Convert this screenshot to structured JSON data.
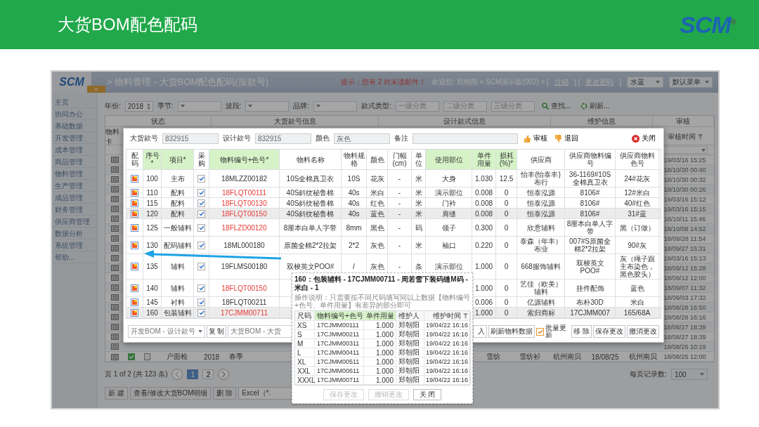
{
  "slide": {
    "title": "大货BOM配色配码",
    "logo": "SCM",
    "logo_mark": "®"
  },
  "header": {
    "logo": "SCM",
    "collapse": "«",
    "breadcrumb": "> 物料管理 - 大货BOM配色配码(按款号)",
    "notice": "提示：您有 2 封未读邮件！",
    "welcome": "欢迎您: 郑朝阳 < SCM演示版(002) > [",
    "logout": "注销",
    "separator": "] [",
    "change_password": "更改密码",
    "closing": "]",
    "theme": "水蓝",
    "menu_mode": "默认菜单"
  },
  "sidebar": {
    "items": [
      "主页",
      "协同办公",
      "基础数据",
      "开发管理",
      "成本管理",
      "商品管理",
      "物料管理",
      "生产管理",
      "成品管理",
      "财务管理",
      "供应商管理",
      "数据分析",
      "系统管理",
      "帮助..."
    ]
  },
  "filters": [
    {
      "kind": "spinner",
      "label": "年份:",
      "value": "2018"
    },
    {
      "kind": "select",
      "label": "季节:"
    },
    {
      "kind": "select",
      "label": "波段:"
    },
    {
      "kind": "select",
      "label": "品牌:"
    },
    {
      "kind": "category",
      "label": "款式类型:",
      "placeholders": [
        "一级分类",
        "二级分类",
        "三级分类"
      ]
    }
  ],
  "find_button": "查找...",
  "refresh_button": "刷新...",
  "table": {
    "groups": [
      "状态",
      "大货款号信息",
      "设计款式信息",
      "维护信息",
      "审核"
    ],
    "first_column": "物料卡",
    "review_time_column": "审核时间",
    "rows": [
      {
        "review_time": "19/03/16 15:25"
      },
      {
        "review_time": "18/10/30 00:40"
      },
      {
        "review_time": "18/10/30 00:32"
      },
      {
        "review_time": "18/10/30 00:26"
      },
      {
        "review_time": "19/03/16 15:12"
      },
      {
        "review_time": "19/03/16 15:15"
      },
      {
        "review_time": "18/10/11 15:46"
      },
      {
        "review_time": "18/10/08 14:52"
      },
      {
        "review_time": "18/09/28 11:54"
      },
      {
        "review_time": "18/09/27 15:31"
      },
      {
        "review_time": "19/03/16 15:13"
      },
      {
        "review_time": "18/09/12 15:28"
      },
      {
        "review_time": "18/09/12 12:00"
      },
      {
        "review_time": "18/09/07 11:32"
      },
      {
        "review_time": "18/09/03 17:32"
      },
      {
        "review_time": "18/08/28 16:50"
      },
      {
        "review_time": "18/08/28 16:16"
      },
      {
        "review_time": "18/08/27 18:39"
      },
      {
        "review_time": "18/08/27 18:39"
      },
      {
        "review_time": "18/08/26 10:19"
      }
    ],
    "last_row": {
      "cells": [
        "户面检",
        "2018",
        "春季",
        "雪纺",
        "雪纺衫",
        "杭州南贝",
        "18/08/25",
        "杭州南贝"
      ],
      "review_time": "18/08/25 12:00"
    }
  },
  "pager": {
    "summary": "页 1 of 2 (共 123 条)",
    "pages": [
      {
        "label": "1",
        "selected": true
      },
      {
        "label": "2",
        "selected": false
      }
    ],
    "page_size_label": "每页记录数:",
    "page_size": "100"
  },
  "actions": [
    "新 建",
    "查看/修改大货BOM明细",
    "删 除"
  ],
  "export_format": "Excel（*.",
  "dialog": {
    "fields": [
      {
        "label": "大货款号",
        "value": "832915"
      },
      {
        "label": "设计款号",
        "value": "832915"
      },
      {
        "label": "颜色",
        "value": "灰色"
      },
      {
        "label": "备注"
      }
    ],
    "approve": "审核",
    "reject": "退回",
    "close": "关闭",
    "columns": [
      {
        "label": "配码",
        "highlight": false
      },
      {
        "label": "序号*",
        "highlight": true
      },
      {
        "label": "项目*",
        "highlight": true
      },
      {
        "label": "采购",
        "highlight": false
      },
      {
        "label": "物料编号+色号*",
        "highlight": true
      },
      {
        "label": "物料名称",
        "highlight": false
      },
      {
        "label": "物料规格",
        "highlight": false
      },
      {
        "label": "颜色",
        "highlight": false
      },
      {
        "label": "门幅(cm)",
        "highlight": false
      },
      {
        "label": "单位",
        "highlight": false
      },
      {
        "label": "使用部位",
        "highlight": true
      },
      {
        "label": "单件用量",
        "highlight": true
      },
      {
        "label": "损耗(%)*",
        "highlight": true
      },
      {
        "label": "供应商",
        "highlight": false
      },
      {
        "label": "供应商物料编号",
        "highlight": false
      },
      {
        "label": "供应商物料色号",
        "highlight": false
      }
    ],
    "rows": [
      {
        "seq": "100",
        "item": "主布",
        "purchase": true,
        "code": "18MLZZ00182",
        "flagged": false,
        "name": "10S全棉真卫衣",
        "spec": "10S",
        "color_name": "花灰",
        "width": "-",
        "unit": "米",
        "part": "大身",
        "qty": "1.030",
        "loss": "12.5",
        "supplier": "怡丰(怡泰丰)布行",
        "supplier_code": "36-1169#10S全棉真卫衣",
        "supplier_color": "24#花灰",
        "selected": false
      },
      {
        "seq": "110",
        "item": "配料",
        "purchase": true,
        "code": "18FLQT00111",
        "flagged": true,
        "name": "40S斜纹秘鲁棉",
        "spec": "40s",
        "color_name": "米白",
        "width": "-",
        "unit": "米",
        "part": "演示部位",
        "qty": "0.008",
        "loss": "0",
        "supplier": "恒泰泓源",
        "supplier_code": "8106#",
        "supplier_color": "12#米白",
        "selected": false
      },
      {
        "seq": "115",
        "item": "配料",
        "purchase": true,
        "code": "18FLQT00130",
        "flagged": true,
        "name": "40S斜纹秘鲁棉",
        "spec": "40s",
        "color_name": "红色",
        "width": "-",
        "unit": "米",
        "part": "门衿",
        "qty": "0.008",
        "loss": "0",
        "supplier": "恒泰泓源",
        "supplier_code": "8106#",
        "supplier_color": "40#红色",
        "selected": false
      },
      {
        "seq": "120",
        "item": "配料",
        "purchase": true,
        "code": "18FLQT00150",
        "flagged": true,
        "name": "40S斜纹秘鲁棉",
        "spec": "40s",
        "color_name": "蓝色",
        "width": "-",
        "unit": "米",
        "part": "肩缝",
        "qty": "0.008",
        "loss": "0",
        "supplier": "恒泰泓源",
        "supplier_code": "8106#",
        "supplier_color": "31#蓝",
        "selected": true
      },
      {
        "seq": "125",
        "item": "一般辅料",
        "purchase": true,
        "code": "18FLZD00120",
        "flagged": true,
        "name": "8厘本白单人字带",
        "spec": "8mm",
        "color_name": "黑色",
        "width": "-",
        "unit": "码",
        "part": "领子",
        "qty": "0.300",
        "loss": "0",
        "supplier": "欣意辅料",
        "supplier_code": "8厘本白单人字带",
        "supplier_color": "黑（订做）",
        "selected": false
      },
      {
        "seq": "130",
        "item": "配码辅料",
        "purchase": true,
        "code": "18ML000180",
        "flagged": false,
        "name": "原菌全棉2*2拉架",
        "spec": "2*2",
        "color_name": "灰色",
        "width": "-",
        "unit": "米",
        "part": "袖口",
        "qty": "0.220",
        "loss": "0",
        "supplier": "泰森（年丰）布业",
        "supplier_code": "007#S原菌全棉2*2拉架",
        "supplier_color": "90#灰",
        "selected": false
      },
      {
        "seq": "135",
        "item": "辅料",
        "purchase": true,
        "code": "19FLMS00180",
        "flagged": false,
        "name": "双梭英文POO#",
        "spec": "/",
        "color_name": "灰色",
        "width": "-",
        "unit": "条",
        "part": "演示部位",
        "qty": "1.000",
        "loss": "0",
        "supplier": "668服饰辅料",
        "supplier_code": "双梭英文POO#",
        "supplier_color": "灰（绳子跟主布染色，黑色胶头）",
        "selected": false
      },
      {
        "seq": "140",
        "item": "辅料",
        "purchase": true,
        "code": "18FLQT00150",
        "flagged": true,
        "qty": "1.000",
        "loss": "0",
        "supplier": "艺佳（欧美）辅料",
        "supplier_code": "挂件配饰",
        "supplier_color": "蓝色",
        "selected": false
      },
      {
        "seq": "145",
        "item": "衬料",
        "purchase": true,
        "code": "18FLQT00211",
        "flagged": false,
        "qty": "0.006",
        "loss": "0",
        "supplier": "亿源辅料",
        "supplier_code": "布朴30D",
        "supplier_color": "米白",
        "selected": false
      },
      {
        "seq": "160",
        "item": "包装辅料",
        "purchase": true,
        "code": "17CJMM00711",
        "flagged": true,
        "qty": "1.000",
        "loss": "0",
        "supplier": "索归商标",
        "supplier_code": "17CJMM007",
        "supplier_color": "165/68A",
        "selected": true
      }
    ],
    "copy_source": "开发BOM - 设计款号",
    "copy_button": "复 制",
    "copy_target": "大货BOM - 大货",
    "import_fragment": "入",
    "refresh_button": "刷新物料数据",
    "batch_update": {
      "label": "批量更新",
      "checked": true
    },
    "remove_button": "移 除",
    "save_button": "保存更改",
    "cancel_button": "撤消更改"
  },
  "popup": {
    "title": "160：包装辅料 - 17CJMM00711 - 周若雪下装码缝M码 - 米白 - 1",
    "note": "操作说明：只需要按不同尺码填写同以上数据【物料编号+色号、单件用量】有差异的部分即可",
    "columns": [
      {
        "label": "尺码",
        "highlight": false
      },
      {
        "label": "物料编号+色号",
        "highlight": true
      },
      {
        "label": "单件用量",
        "highlight": true
      },
      {
        "label": "维护人",
        "highlight": false
      },
      {
        "label": "维护时间",
        "highlight": false
      }
    ],
    "rows": [
      {
        "size": "XS",
        "code": "17CJMM00111",
        "qty": "1.000",
        "maintainer": "郑朝阳",
        "time": "19/04/22 16:16"
      },
      {
        "size": "S",
        "code": "17CJMM00211",
        "qty": "1.000",
        "maintainer": "郑朝阳",
        "time": "19/04/22 16:16"
      },
      {
        "size": "M",
        "code": "17CJMM00311",
        "qty": "1.000",
        "maintainer": "郑朝阳",
        "time": "19/04/22 16:16"
      },
      {
        "size": "L",
        "code": "17CJMM00411",
        "qty": "1.000",
        "maintainer": "郑朝阳",
        "time": "19/04/22 16:16"
      },
      {
        "size": "XL",
        "code": "17CJMM00511",
        "qty": "1.000",
        "maintainer": "郑朝阳",
        "time": "19/04/22 16:16"
      },
      {
        "size": "XXL",
        "code": "17CJMM00611",
        "qty": "1.000",
        "maintainer": "郑朝阳",
        "time": "19/04/22 16:16"
      },
      {
        "size": "XXXL",
        "code": "17CJMM00711",
        "qty": "1.000",
        "maintainer": "郑朝阳",
        "time": "19/04/22 16:16"
      }
    ],
    "buttons": [
      {
        "label": "保存更改",
        "disabled": true
      },
      {
        "label": "撤销更改",
        "disabled": true
      },
      {
        "label": "关 闭",
        "disabled": false
      }
    ]
  }
}
